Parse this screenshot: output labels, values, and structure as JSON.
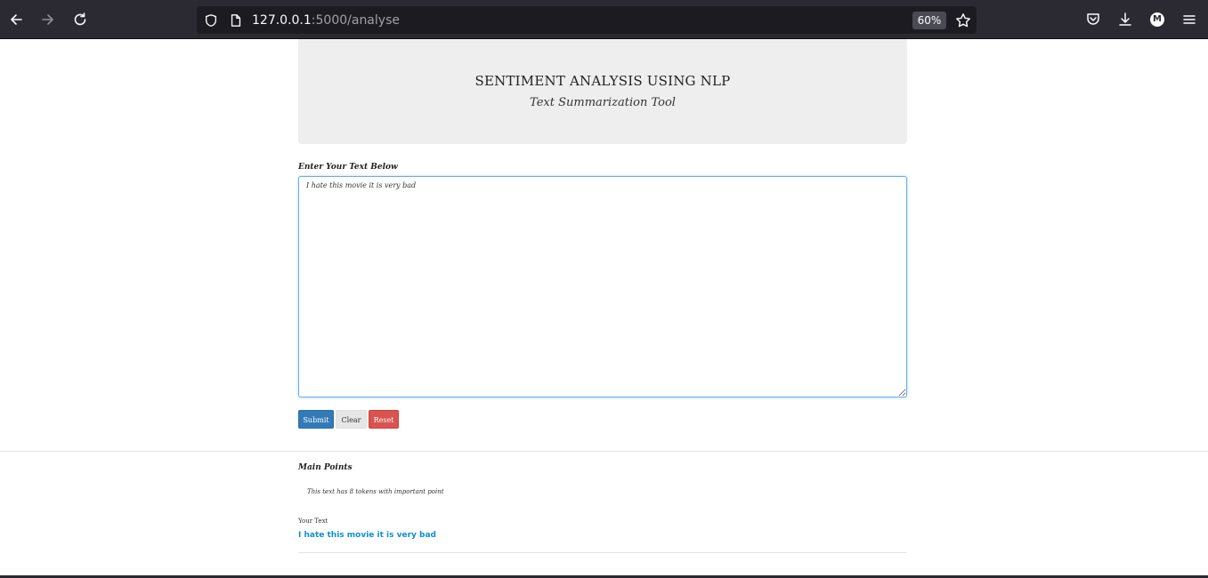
{
  "browser": {
    "url_host": "127.0.0.1",
    "url_path": ":5000/analyse",
    "zoom": "60%",
    "avatar_letter": "M"
  },
  "header": {
    "title": "SENTIMENT ANALYSIS USING NLP",
    "subtitle": "Text Summarization Tool"
  },
  "form": {
    "label": "Enter Your Text Below",
    "text_value": "I hate this movie it is very bad",
    "submit_label": "Submit",
    "clear_label": "Clear",
    "reset_label": "Reset"
  },
  "results": {
    "heading": "Main Points",
    "token_info": "This text has 8 tokens with important point",
    "your_text_label": "Your Text",
    "your_text_value": "I hate this movie it is very bad"
  },
  "colors": {
    "primary": "#337ab7",
    "danger": "#d9534f",
    "link": "#0e90d2"
  }
}
